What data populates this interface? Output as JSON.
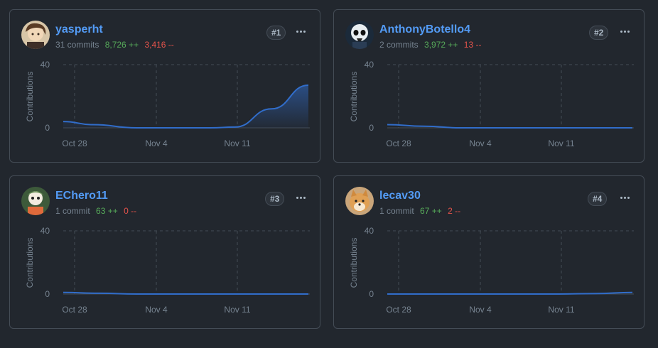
{
  "cards": [
    {
      "username": "yasperht",
      "commits": "31 commits",
      "additions": "8,726 ++",
      "deletions": "3,416 --",
      "rank": "#1",
      "avatar": "anime-character-avatar",
      "chart_data": {
        "type": "area",
        "ylabel": "Contributions",
        "ylim": [
          0,
          40
        ],
        "y_ticks": [
          "40",
          "0"
        ],
        "x_ticks": [
          "Oct 28",
          "Nov 4",
          "Nov 11"
        ],
        "line_color": "#316dca",
        "fill": true,
        "points": [
          [
            0,
            4
          ],
          [
            0.12,
            2
          ],
          [
            0.3,
            0
          ],
          [
            0.6,
            0
          ],
          [
            0.7,
            0.5
          ],
          [
            0.85,
            12
          ],
          [
            1,
            27
          ]
        ]
      }
    },
    {
      "username": "AnthonyBotello4",
      "commits": "2 commits",
      "additions": "3,972 ++",
      "deletions": "13 --",
      "rank": "#2",
      "avatar": "skull-character-avatar",
      "chart_data": {
        "type": "line",
        "ylabel": "Contributions",
        "ylim": [
          0,
          40
        ],
        "y_ticks": [
          "40",
          "0"
        ],
        "x_ticks": [
          "Oct 28",
          "Nov 4",
          "Nov 11"
        ],
        "line_color": "#316dca",
        "fill": false,
        "points": [
          [
            0,
            2
          ],
          [
            0.15,
            1
          ],
          [
            0.3,
            0
          ],
          [
            1,
            0
          ]
        ]
      }
    },
    {
      "username": "EChero11",
      "commits": "1 commit",
      "additions": "63 ++",
      "deletions": "0 --",
      "rank": "#3",
      "avatar": "cartoon-character-avatar",
      "chart_data": {
        "type": "line",
        "ylabel": "Contributions",
        "ylim": [
          0,
          40
        ],
        "y_ticks": [
          "40",
          "0"
        ],
        "x_ticks": [
          "Oct 28",
          "Nov 4",
          "Nov 11"
        ],
        "line_color": "#316dca",
        "fill": false,
        "points": [
          [
            0,
            1
          ],
          [
            0.15,
            0.5
          ],
          [
            0.3,
            0
          ],
          [
            1,
            0
          ]
        ]
      }
    },
    {
      "username": "lecav30",
      "commits": "1 commit",
      "additions": "67 ++",
      "deletions": "2 --",
      "rank": "#4",
      "avatar": "shiba-dog-avatar",
      "chart_data": {
        "type": "line",
        "ylabel": "Contributions",
        "ylim": [
          0,
          40
        ],
        "y_ticks": [
          "40",
          "0"
        ],
        "x_ticks": [
          "Oct 28",
          "Nov 4",
          "Nov 11"
        ],
        "line_color": "#316dca",
        "fill": false,
        "points": [
          [
            0,
            0
          ],
          [
            0.7,
            0
          ],
          [
            0.85,
            0.3
          ],
          [
            1,
            1
          ]
        ]
      }
    }
  ]
}
